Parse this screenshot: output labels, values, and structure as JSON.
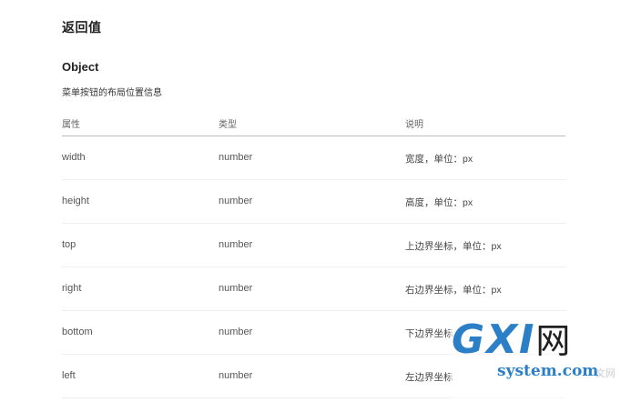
{
  "section_title": "返回值",
  "object": {
    "title": "Object",
    "description": "菜单按钮的布局位置信息"
  },
  "table": {
    "headers": [
      "属性",
      "类型",
      "说明"
    ],
    "rows": [
      {
        "property": "width",
        "type": "number",
        "description": "宽度，单位：px"
      },
      {
        "property": "height",
        "type": "number",
        "description": "高度，单位：px"
      },
      {
        "property": "top",
        "type": "number",
        "description": "上边界坐标，单位：px"
      },
      {
        "property": "right",
        "type": "number",
        "description": "右边界坐标，单位：px"
      },
      {
        "property": "bottom",
        "type": "number",
        "description": "下边界坐标"
      },
      {
        "property": "left",
        "type": "number",
        "description": "左边界坐标"
      }
    ]
  },
  "watermark": {
    "logo_latin": "GXI",
    "logo_cn": "网",
    "site": "system.com",
    "tail": "文网"
  }
}
